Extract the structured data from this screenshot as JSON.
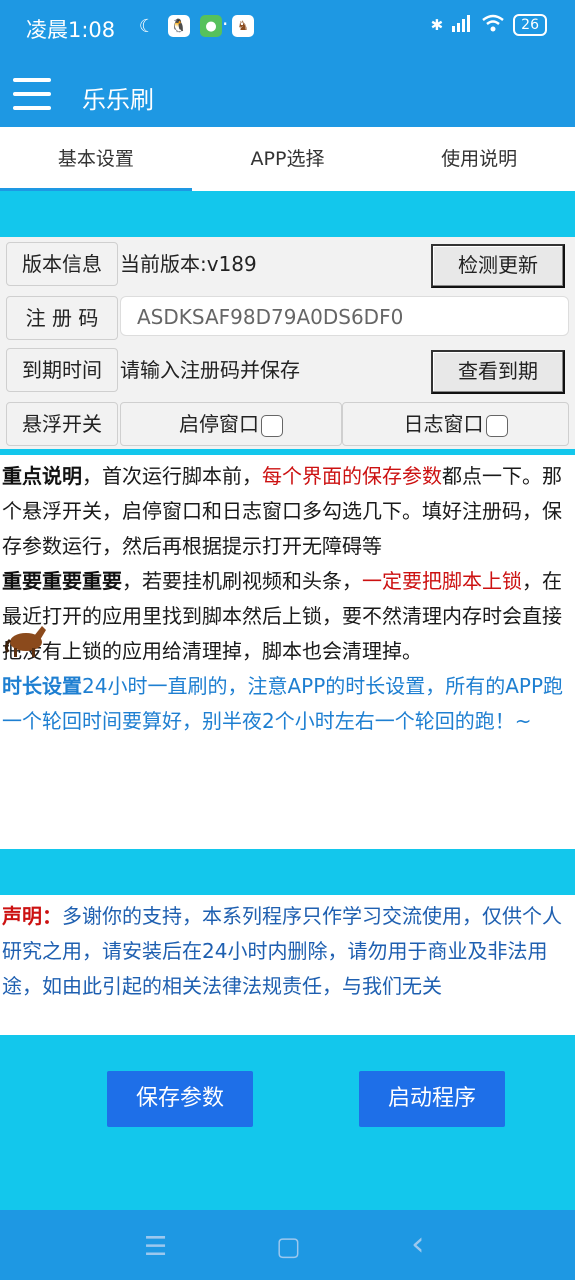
{
  "status_bar": {
    "time": "凌晨1:08",
    "battery": "26",
    "dots": "···"
  },
  "app_bar": {
    "title": "乐乐刷"
  },
  "tabs": [
    {
      "label": "基本设置"
    },
    {
      "label": "APP选择"
    },
    {
      "label": "使用说明"
    }
  ],
  "settings": {
    "version_label": "版本信息",
    "version_value": "当前版本:v189",
    "check_update": "检测更新",
    "reg_label": "注 册 码",
    "reg_value": "ASDKSAF98D79A0DS6DF0",
    "expire_label": "到期时间",
    "expire_value": "请输入注册码并保存",
    "view_expire": "查看到期",
    "float_label": "悬浮开关",
    "start_window": "启停窗口",
    "log_window": "日志窗口"
  },
  "notes": {
    "p1_head": "重点说明",
    "p1_a": "，首次运行脚本前，",
    "p1_red": "每个界面的保存参数",
    "p1_b": "都点一下。那个悬浮开关，启停窗口和日志窗口多勾选几下。填好注册码，保存参数运行，然后再根据提示打开无障碍等",
    "p2_head": "重要重要重要",
    "p2_a": "，若要挂机刷视频和头条，",
    "p2_red": "一定要把脚本上锁",
    "p2_b": "，在最近打开的应用里找到脚本然后上锁，要不然清理内存时会直接把没有上锁的应用给清理掉，脚本也会清理掉。",
    "p3_head": "时长设置",
    "p3_a": "24小时一直刷的，注意APP的时长设置，所有的APP跑一个轮回时间要算好，别半夜2个小时左右一个轮回的跑！~"
  },
  "disclaimer": {
    "head": "声明：",
    "body": "多谢你的支持，本系列程序只作学习交流使用，仅供个人研究之用，请安装后在24小时内删除，请勿用于商业及非法用途，如由此引起的相关法律法规责任，与我们无关"
  },
  "actions": {
    "save": "保存参数",
    "start": "启动程序"
  },
  "navbar": {
    "menu_glyph": "☰",
    "home_glyph": "▢",
    "back_glyph": "‹"
  },
  "colors": {
    "primary": "#1E98E3",
    "background": "#13C7EC",
    "button": "#1E6FE8",
    "emphasis_red": "#CC1111",
    "blue_text": "#1E7FD1"
  }
}
